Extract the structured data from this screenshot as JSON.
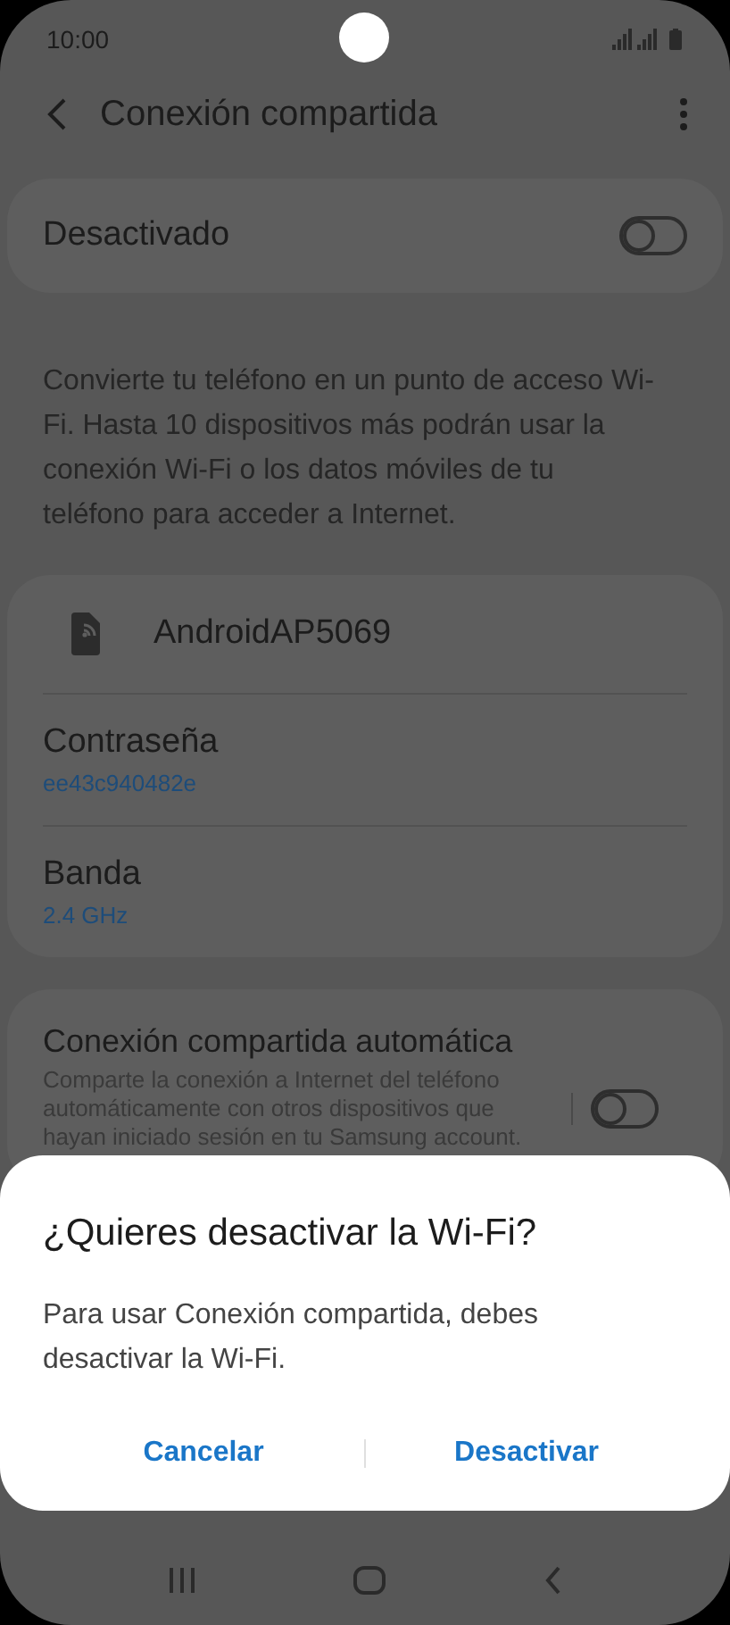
{
  "status_bar": {
    "time": "10:00"
  },
  "header": {
    "title": "Conexión compartida"
  },
  "master_switch": {
    "label": "Desactivado",
    "on": false
  },
  "description": "Convierte tu teléfono en un punto de acceso Wi-Fi. Hasta 10 dispositivos más podrán usar la conexión Wi-Fi o los datos móviles de tu teléfono para acceder a Internet.",
  "network": {
    "name": "AndroidAP5069",
    "settings": [
      {
        "label": "Contraseña",
        "value": "ee43c940482e"
      },
      {
        "label": "Banda",
        "value": "2.4 GHz"
      }
    ]
  },
  "auto_hotspot": {
    "title": "Conexión compartida automática",
    "summary": "Comparte la conexión a Internet del teléfono automáticamente con otros dispositivos que hayan iniciado sesión en tu Samsung account.",
    "on": false
  },
  "dialog": {
    "title": "¿Quieres desactivar la Wi-Fi?",
    "message": "Para usar Conexión compartida, debes desactivar la Wi-Fi.",
    "buttons": [
      "Cancelar",
      "Desactivar"
    ]
  }
}
